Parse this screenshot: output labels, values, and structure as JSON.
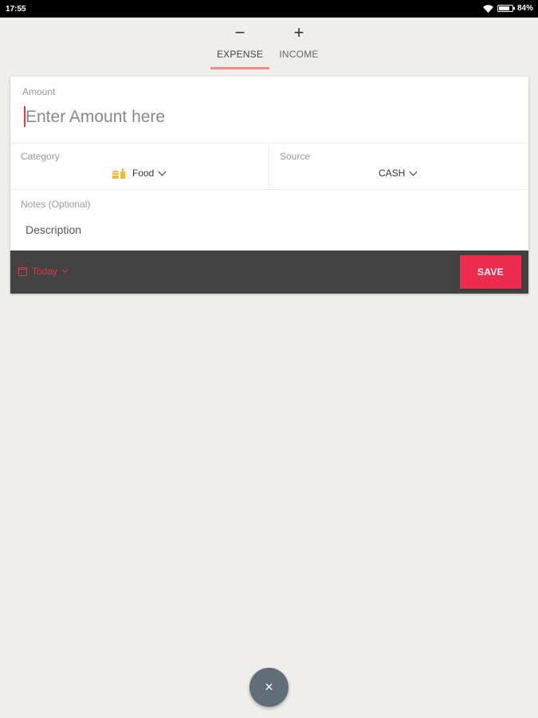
{
  "status_bar": {
    "time": "17:55",
    "battery": "84%",
    "battery_level": 0.84,
    "wifi_icon": "wifi-icon"
  },
  "tabs": [
    {
      "icon": "−",
      "label": "EXPENSE",
      "selected": true
    },
    {
      "icon": "+",
      "label": "INCOME",
      "selected": false
    }
  ],
  "form": {
    "amount_label": "Amount",
    "amount_placeholder": "Enter Amount here",
    "amount_value": "",
    "category_label": "Category",
    "category_value": "Food",
    "category_icon": "food-icon",
    "source_label": "Source",
    "source_value": "CASH",
    "notes_label": "Notes (Optional)",
    "notes_placeholder": "Description",
    "notes_value": ""
  },
  "action_bar": {
    "date_value": "Today",
    "date_icon": "calendar-icon",
    "save_label": "SAVE"
  },
  "fab": {
    "label": "×",
    "icon": "close-icon"
  },
  "colors": {
    "accent": "#ed2b4e",
    "tab_underline": "#f08a7f",
    "action_bar": "#424242",
    "fab": "#5f6e79",
    "background": "#efeeeb"
  }
}
